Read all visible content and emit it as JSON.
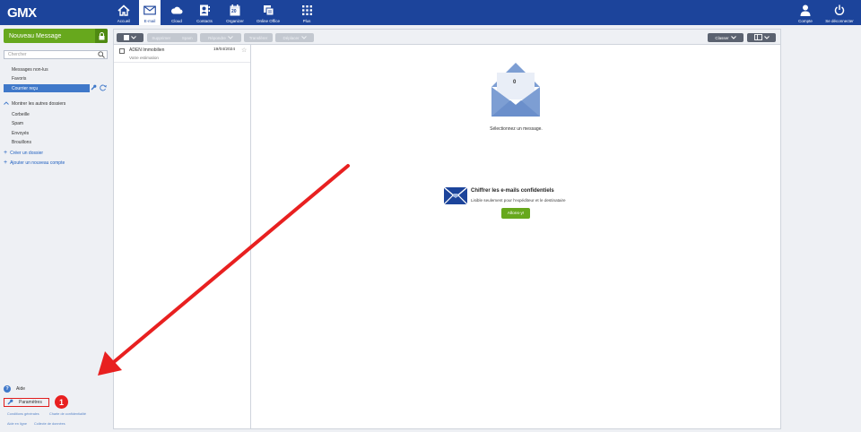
{
  "brand": {
    "logo": "GMX"
  },
  "nav": {
    "items": [
      {
        "label": "Accueil",
        "icon": "home-icon"
      },
      {
        "label": "E-mail",
        "icon": "mail-icon",
        "active": true
      },
      {
        "label": "Cloud",
        "icon": "cloud-icon"
      },
      {
        "label": "Contacts",
        "icon": "contacts-icon"
      },
      {
        "label": "Organizer",
        "icon": "calendar-icon",
        "day": "20"
      },
      {
        "label": "Online Office",
        "icon": "office-icon"
      },
      {
        "label": "Plus",
        "icon": "grid-icon"
      }
    ],
    "account": {
      "label": "Compte",
      "icon": "user-icon"
    },
    "logout": {
      "label": "Se déconnecter",
      "icon": "power-icon"
    }
  },
  "sidebar": {
    "new_message": "Nouveau Message",
    "search_placeholder": "Chercher",
    "folders": [
      {
        "label": "Messages non-lus"
      },
      {
        "label": "Favoris"
      },
      {
        "label": "Courrier reçu",
        "selected": true
      }
    ],
    "toggle_label": "Montrer les autres dossiers",
    "other_folders": [
      {
        "label": "Corbeille"
      },
      {
        "label": "Spam"
      },
      {
        "label": "Envoyés"
      },
      {
        "label": "Brouillons"
      }
    ],
    "create_folder": "Créer un dossier",
    "add_account": "Ajouter un nouveau compte",
    "help": "Aide",
    "settings": "Paramètres",
    "footer_links": [
      "Conditions générales",
      "Charte de confidentialité",
      "Aide en ligne",
      "Collecte de données"
    ]
  },
  "toolbar": {
    "delete": "Supprimer",
    "spam": "Spam",
    "reply": "Répondre",
    "forward": "Transférer",
    "move": "Déplacer",
    "sort": "Classer"
  },
  "messages": [
    {
      "from": "ADEN Immobilien",
      "date": "19/04/2024",
      "subject": "Votre estimation"
    }
  ],
  "preview": {
    "selected_count": "0",
    "select_prompt": "Sélectionnez un message.",
    "encrypt_title": "Chiffrer les e-mails confidentiels",
    "encrypt_desc": "Lisible seulement pour l'expéditeur et le destinataire",
    "encrypt_button": "Allons-y!"
  },
  "annotation": {
    "step": "1",
    "color": "#e82020"
  },
  "colors": {
    "brand": "#1c449b",
    "accent_green": "#67a81d",
    "selection": "#3f78c9",
    "annotation_red": "#e82020"
  }
}
